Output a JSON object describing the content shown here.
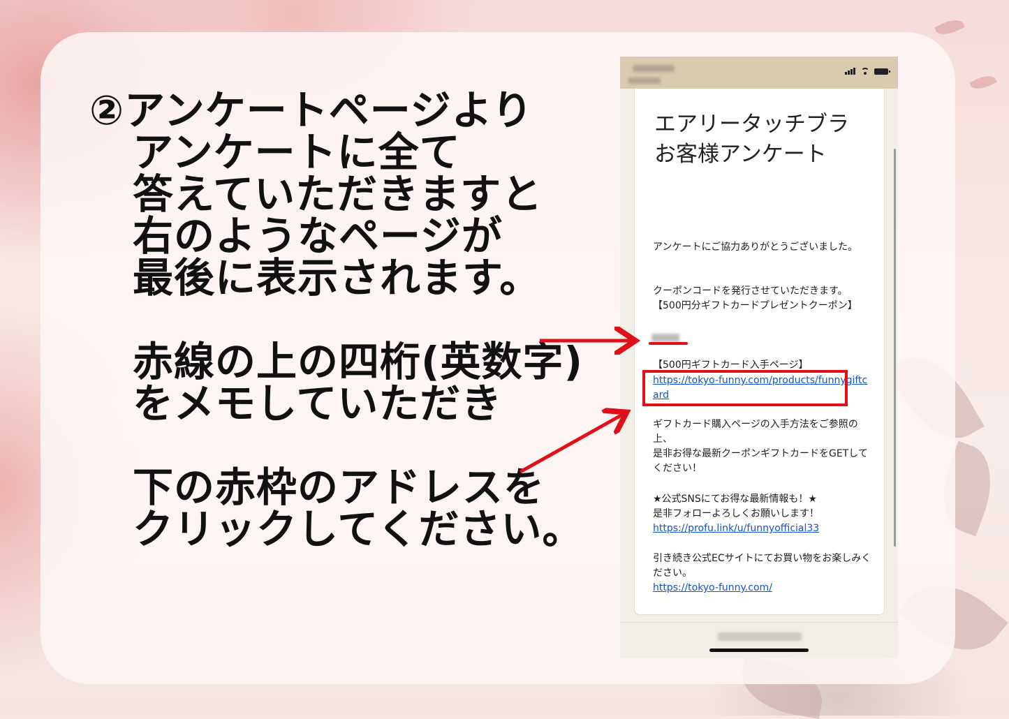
{
  "instruction": {
    "line1": "②アンケートページより",
    "line2": "アンケートに全て",
    "line3": "答えていただきますと",
    "line4": "右のようなページが",
    "line5": "最後に表示されます。",
    "line6": "赤線の上の四桁(英数字)",
    "line7": "をメモしていただき",
    "line8": "下の赤枠のアドレスを",
    "line9": "クリックしてください。"
  },
  "phone": {
    "form_title": "エアリータッチブラお客様アンケート",
    "thanks": "アンケートにご協力ありがとうございました。",
    "coupon_intro": "クーポンコードを発行させていただきます。",
    "coupon_heading": "【500円分ギフトカードプレゼントクーポン】",
    "gift_page_heading": "【500円ギフトカード入手ページ】",
    "gift_link": "https://tokyo-funny.com/products/funnygiftcard",
    "how_to": "ギフトカード購入ページの入手方法をご参照の上、",
    "get_text": "是非お得な最新クーポンギフトカードをGETしてください！",
    "sns_heading": "★公式SNSにてお得な最新情報も！★",
    "follow": "是非フォローよろしくお願いします！",
    "sns_link": "https://profu.link/u/funnyofficial33",
    "ec_text": "引き続き公式ECサイトにてお買い物をお楽しみください。",
    "ec_link": "https://tokyo-funny.com/"
  },
  "colors": {
    "accent_red": "#e0101a",
    "link_blue": "#1155cc",
    "status_bar": "#d8cbb0"
  }
}
